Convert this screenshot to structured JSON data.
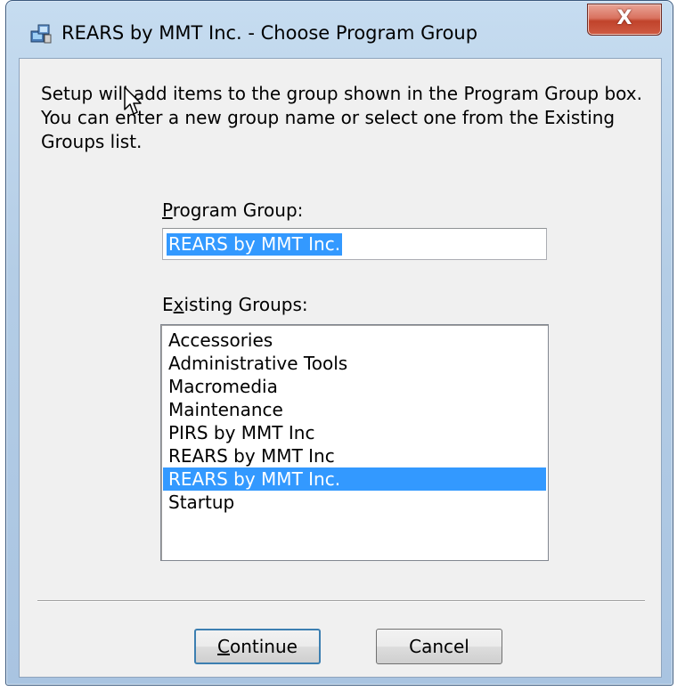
{
  "window": {
    "title": "REARS by MMT Inc. - Choose Program Group",
    "close_glyph": "X",
    "icon": "setup-computer-icon"
  },
  "description": "Setup will add items to the group shown in the Program Group box. You can enter a new group name or select one from the Existing Groups list.",
  "program_group": {
    "label_mnemonic": "P",
    "label_rest": "rogram Group:",
    "value": "REARS by MMT Inc."
  },
  "existing_groups": {
    "label_prefix": "E",
    "label_mnemonic": "x",
    "label_rest": "isting Groups:",
    "items": [
      "Accessories",
      "Administrative Tools",
      "Macromedia",
      "Maintenance",
      "PIRS by MMT Inc",
      "REARS by MMT Inc",
      "REARS by MMT Inc.",
      "Startup"
    ],
    "selected": "REARS by MMT Inc."
  },
  "buttons": {
    "continue_mnemonic": "C",
    "continue_rest": "ontinue",
    "cancel": "Cancel"
  },
  "colors": {
    "selection": "#3399ff",
    "close_button": "#c0432b",
    "title_bar": "#b4cde6"
  }
}
